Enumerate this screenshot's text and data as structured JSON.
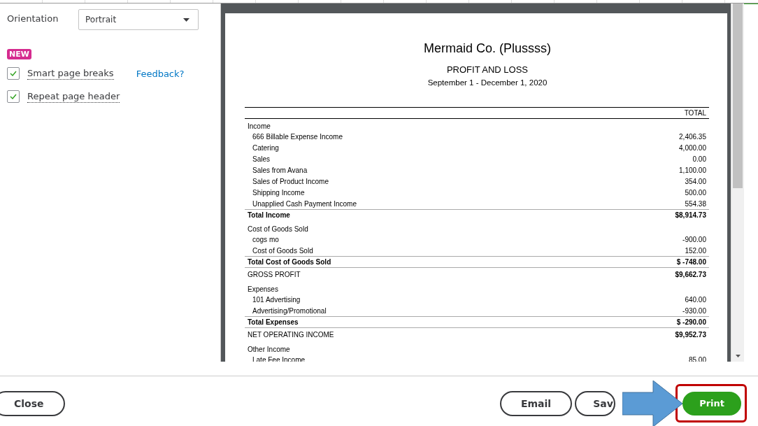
{
  "settings": {
    "orientation": {
      "label": "Orientation",
      "value": "Portrait"
    },
    "badge": "NEW",
    "options": [
      {
        "label": "Smart page breaks",
        "checked": true,
        "link": "Feedback?"
      },
      {
        "label": "Repeat page header",
        "checked": true
      }
    ]
  },
  "report": {
    "company": "Mermaid Co. (Plussss)",
    "title": "PROFIT AND LOSS",
    "period": "September 1 - December 1, 2020",
    "column": "TOTAL",
    "rows": [
      {
        "kind": "section",
        "name": "Income"
      },
      {
        "kind": "item",
        "name": "666 Billable Expense Income",
        "value": "2,406.35"
      },
      {
        "kind": "item",
        "name": "Catering",
        "value": "4,000.00"
      },
      {
        "kind": "item",
        "name": "Sales",
        "value": "0.00"
      },
      {
        "kind": "item",
        "name": "Sales from Avana",
        "value": "1,100.00"
      },
      {
        "kind": "item",
        "name": "Sales of Product Income",
        "value": "354.00"
      },
      {
        "kind": "item",
        "name": "Shipping Income",
        "value": "500.00"
      },
      {
        "kind": "item",
        "name": "Unapplied Cash Payment Income",
        "value": "554.38"
      },
      {
        "kind": "total",
        "name": "Total Income",
        "value": "$8,914.73"
      },
      {
        "kind": "section",
        "name": "Cost of Goods Sold"
      },
      {
        "kind": "item",
        "name": "cogs mo",
        "value": "-900.00"
      },
      {
        "kind": "item",
        "name": "Cost of Goods Sold",
        "value": "152.00"
      },
      {
        "kind": "total",
        "name": "Total Cost of Goods Sold",
        "value": "$ -748.00"
      },
      {
        "kind": "summary",
        "name": "GROSS PROFIT",
        "value": "$9,662.73"
      },
      {
        "kind": "section",
        "name": "Expenses"
      },
      {
        "kind": "item",
        "name": "101 Advertising",
        "value": "640.00"
      },
      {
        "kind": "item",
        "name": "Advertising/Promotional",
        "value": "-930.00"
      },
      {
        "kind": "total",
        "name": "Total Expenses",
        "value": "$ -290.00"
      },
      {
        "kind": "summary",
        "name": "NET OPERATING INCOME",
        "value": "$9,952.73"
      },
      {
        "kind": "section",
        "name": "Other Income"
      },
      {
        "kind": "item",
        "name": "Late Fee Income",
        "value": "85.00"
      }
    ]
  },
  "footer": {
    "buttons": [
      {
        "label": "Close",
        "kind": "secondary"
      },
      {
        "label": "Email",
        "kind": "secondary"
      },
      {
        "label": "Sav",
        "kind": "secondary"
      },
      {
        "label": "Print",
        "kind": "primary"
      }
    ]
  }
}
